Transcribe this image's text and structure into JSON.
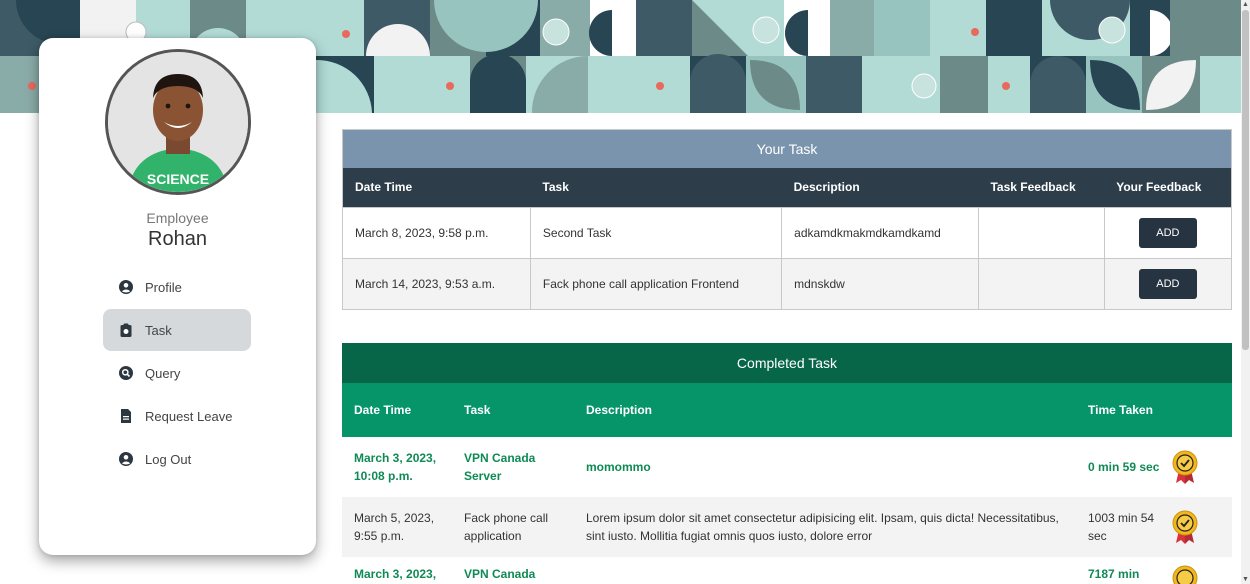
{
  "profile": {
    "role": "Employee",
    "name": "Rohan",
    "avatar_shirt_text": "SCIENCE"
  },
  "nav": {
    "items": [
      {
        "label": "Profile",
        "icon": "user-icon"
      },
      {
        "label": "Task",
        "icon": "task-icon",
        "active": true
      },
      {
        "label": "Query",
        "icon": "search-icon"
      },
      {
        "label": "Request Leave",
        "icon": "document-icon"
      },
      {
        "label": "Log Out",
        "icon": "user-icon"
      }
    ]
  },
  "your_task": {
    "title": "Your Task",
    "headers": [
      "Date Time",
      "Task",
      "Description",
      "Task Feedback",
      "Your Feedback"
    ],
    "rows": [
      {
        "date": "March 8, 2023, 9:58 p.m.",
        "task": "Second Task",
        "description": "adkamdkmakmdkamdkamd",
        "feedback": "",
        "action": "ADD"
      },
      {
        "date": "March 14, 2023, 9:53 a.m.",
        "task": "Fack phone call application Frontend",
        "description": "mdnskdw",
        "feedback": "",
        "action": "ADD"
      }
    ]
  },
  "completed_task": {
    "title": "Completed Task",
    "headers": [
      "Date Time",
      "Task",
      "Description",
      "Time Taken"
    ],
    "rows": [
      {
        "date": "March 3, 2023, 10:08 p.m.",
        "task": "VPN Canada Server",
        "description": "momommo",
        "time": "0 min 59 sec"
      },
      {
        "date": "March 5, 2023, 9:55 p.m.",
        "task": "Fack phone call application",
        "description": "Lorem ipsum dolor sit amet consectetur adipisicing elit. Ipsam, quis dicta! Necessitatibus, sint iusto. Mollitia fugiat omnis quos iusto, dolore error",
        "time": "1003 min 54 sec"
      },
      {
        "date": "March 3, 2023,",
        "task": "VPN Canada",
        "description": "",
        "time": "7187 min"
      }
    ]
  },
  "colors": {
    "task_title_bg": "#7b94ad",
    "task_header_bg": "#2d3d4a",
    "completed_title_bg": "#086648",
    "completed_header_bg": "#069469",
    "completed_text": "#0f8a55",
    "badge_gold": "#f3b71c",
    "badge_red": "#d8323c"
  }
}
